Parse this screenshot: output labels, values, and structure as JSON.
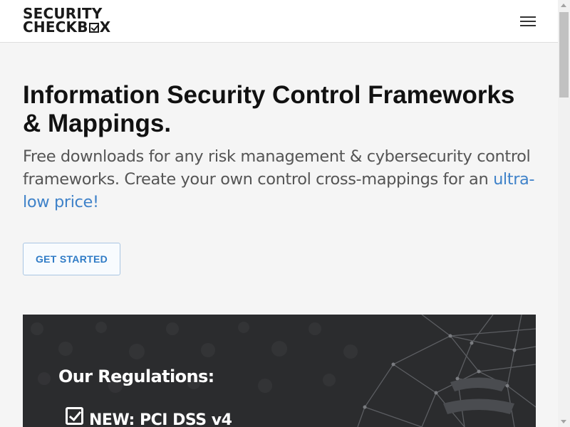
{
  "header": {
    "logo_line1": "SECURITY",
    "logo_line2_pre": "CHECKB",
    "logo_line2_post": "X",
    "menu_icon": "hamburger-menu-icon"
  },
  "hero": {
    "title": "Information Security Control Frameworks & Mappings.",
    "subtitle_text": "Free downloads for any risk management & cybersecurity control frameworks. Create your own control cross-mappings for an ",
    "subtitle_link": "ultra-low price!",
    "cta_label": "GET STARTED"
  },
  "banner": {
    "title": "Our Regulations:",
    "items": [
      {
        "label": "NEW: PCI DSS v4",
        "icon": "checkbox-checked-icon"
      }
    ]
  },
  "colors": {
    "accent": "#3f82c9",
    "page_bg": "#f5f5f5",
    "banner_bg": "#2b2c2e"
  }
}
